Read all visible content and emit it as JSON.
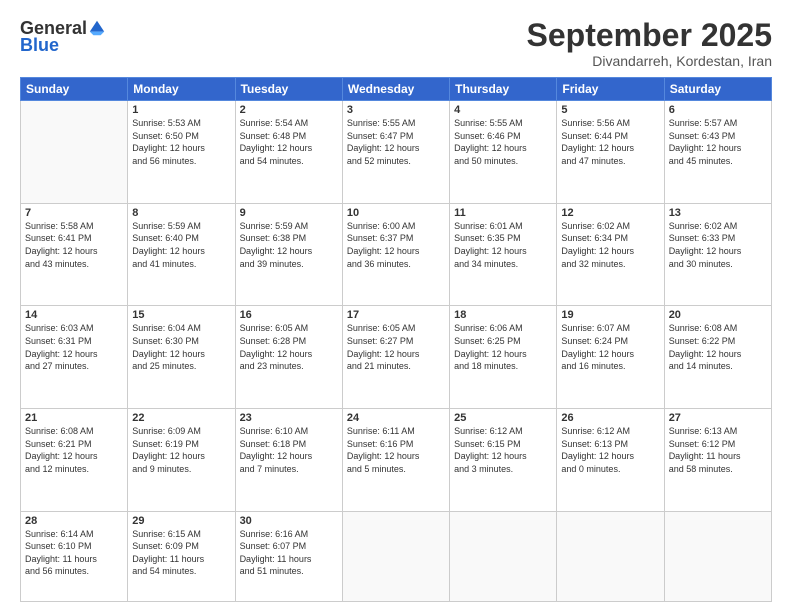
{
  "logo": {
    "general": "General",
    "blue": "Blue"
  },
  "title": {
    "month": "September 2025",
    "location": "Divandarreh, Kordestan, Iran"
  },
  "weekdays": [
    "Sunday",
    "Monday",
    "Tuesday",
    "Wednesday",
    "Thursday",
    "Friday",
    "Saturday"
  ],
  "weeks": [
    [
      {
        "day": "",
        "info": ""
      },
      {
        "day": "1",
        "info": "Sunrise: 5:53 AM\nSunset: 6:50 PM\nDaylight: 12 hours\nand 56 minutes."
      },
      {
        "day": "2",
        "info": "Sunrise: 5:54 AM\nSunset: 6:48 PM\nDaylight: 12 hours\nand 54 minutes."
      },
      {
        "day": "3",
        "info": "Sunrise: 5:55 AM\nSunset: 6:47 PM\nDaylight: 12 hours\nand 52 minutes."
      },
      {
        "day": "4",
        "info": "Sunrise: 5:55 AM\nSunset: 6:46 PM\nDaylight: 12 hours\nand 50 minutes."
      },
      {
        "day": "5",
        "info": "Sunrise: 5:56 AM\nSunset: 6:44 PM\nDaylight: 12 hours\nand 47 minutes."
      },
      {
        "day": "6",
        "info": "Sunrise: 5:57 AM\nSunset: 6:43 PM\nDaylight: 12 hours\nand 45 minutes."
      }
    ],
    [
      {
        "day": "7",
        "info": "Sunrise: 5:58 AM\nSunset: 6:41 PM\nDaylight: 12 hours\nand 43 minutes."
      },
      {
        "day": "8",
        "info": "Sunrise: 5:59 AM\nSunset: 6:40 PM\nDaylight: 12 hours\nand 41 minutes."
      },
      {
        "day": "9",
        "info": "Sunrise: 5:59 AM\nSunset: 6:38 PM\nDaylight: 12 hours\nand 39 minutes."
      },
      {
        "day": "10",
        "info": "Sunrise: 6:00 AM\nSunset: 6:37 PM\nDaylight: 12 hours\nand 36 minutes."
      },
      {
        "day": "11",
        "info": "Sunrise: 6:01 AM\nSunset: 6:35 PM\nDaylight: 12 hours\nand 34 minutes."
      },
      {
        "day": "12",
        "info": "Sunrise: 6:02 AM\nSunset: 6:34 PM\nDaylight: 12 hours\nand 32 minutes."
      },
      {
        "day": "13",
        "info": "Sunrise: 6:02 AM\nSunset: 6:33 PM\nDaylight: 12 hours\nand 30 minutes."
      }
    ],
    [
      {
        "day": "14",
        "info": "Sunrise: 6:03 AM\nSunset: 6:31 PM\nDaylight: 12 hours\nand 27 minutes."
      },
      {
        "day": "15",
        "info": "Sunrise: 6:04 AM\nSunset: 6:30 PM\nDaylight: 12 hours\nand 25 minutes."
      },
      {
        "day": "16",
        "info": "Sunrise: 6:05 AM\nSunset: 6:28 PM\nDaylight: 12 hours\nand 23 minutes."
      },
      {
        "day": "17",
        "info": "Sunrise: 6:05 AM\nSunset: 6:27 PM\nDaylight: 12 hours\nand 21 minutes."
      },
      {
        "day": "18",
        "info": "Sunrise: 6:06 AM\nSunset: 6:25 PM\nDaylight: 12 hours\nand 18 minutes."
      },
      {
        "day": "19",
        "info": "Sunrise: 6:07 AM\nSunset: 6:24 PM\nDaylight: 12 hours\nand 16 minutes."
      },
      {
        "day": "20",
        "info": "Sunrise: 6:08 AM\nSunset: 6:22 PM\nDaylight: 12 hours\nand 14 minutes."
      }
    ],
    [
      {
        "day": "21",
        "info": "Sunrise: 6:08 AM\nSunset: 6:21 PM\nDaylight: 12 hours\nand 12 minutes."
      },
      {
        "day": "22",
        "info": "Sunrise: 6:09 AM\nSunset: 6:19 PM\nDaylight: 12 hours\nand 9 minutes."
      },
      {
        "day": "23",
        "info": "Sunrise: 6:10 AM\nSunset: 6:18 PM\nDaylight: 12 hours\nand 7 minutes."
      },
      {
        "day": "24",
        "info": "Sunrise: 6:11 AM\nSunset: 6:16 PM\nDaylight: 12 hours\nand 5 minutes."
      },
      {
        "day": "25",
        "info": "Sunrise: 6:12 AM\nSunset: 6:15 PM\nDaylight: 12 hours\nand 3 minutes."
      },
      {
        "day": "26",
        "info": "Sunrise: 6:12 AM\nSunset: 6:13 PM\nDaylight: 12 hours\nand 0 minutes."
      },
      {
        "day": "27",
        "info": "Sunrise: 6:13 AM\nSunset: 6:12 PM\nDaylight: 11 hours\nand 58 minutes."
      }
    ],
    [
      {
        "day": "28",
        "info": "Sunrise: 6:14 AM\nSunset: 6:10 PM\nDaylight: 11 hours\nand 56 minutes."
      },
      {
        "day": "29",
        "info": "Sunrise: 6:15 AM\nSunset: 6:09 PM\nDaylight: 11 hours\nand 54 minutes."
      },
      {
        "day": "30",
        "info": "Sunrise: 6:16 AM\nSunset: 6:07 PM\nDaylight: 11 hours\nand 51 minutes."
      },
      {
        "day": "",
        "info": ""
      },
      {
        "day": "",
        "info": ""
      },
      {
        "day": "",
        "info": ""
      },
      {
        "day": "",
        "info": ""
      }
    ]
  ]
}
